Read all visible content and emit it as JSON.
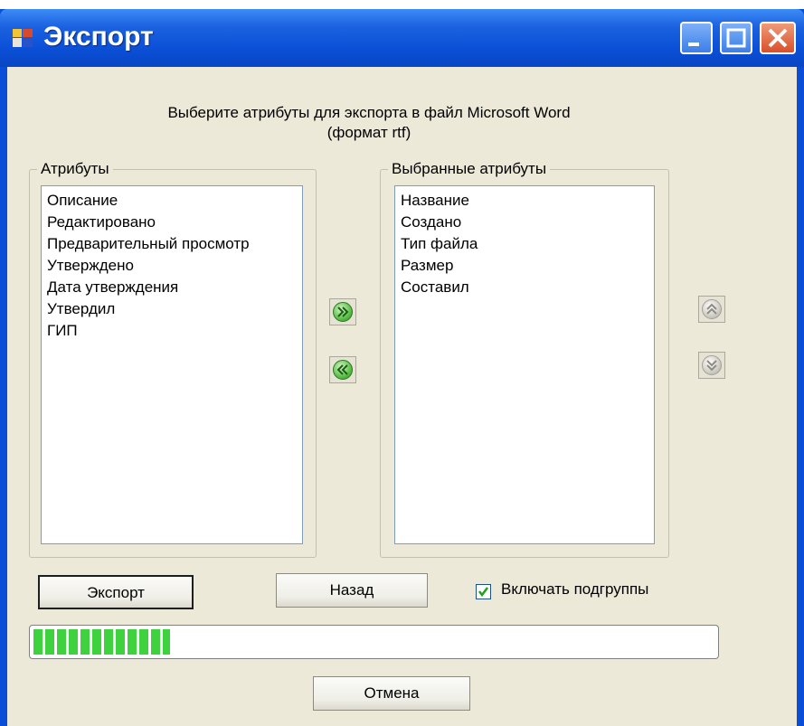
{
  "window": {
    "title": "Экспорт",
    "buttons": {
      "minimize": "minimize-icon",
      "maximize": "maximize-icon",
      "close": "close-icon"
    }
  },
  "heading": {
    "line1": "Выберите атрибуты для экспорта в файл Microsoft Word",
    "line2": "(формат rtf)"
  },
  "available": {
    "label": "Атрибуты",
    "items": [
      "Описание",
      "Редактировано",
      "Предварительный просмотр",
      "Утверждено",
      "Дата утверждения",
      "Утвердил",
      "ГИП"
    ]
  },
  "selected": {
    "label": "Выбранные атрибуты",
    "items": [
      "Название",
      "Создано",
      "Тип файла",
      "Размер",
      "Составил"
    ]
  },
  "transfer": {
    "add_icon": "double-chevron-right-icon",
    "remove_icon": "double-chevron-left-icon"
  },
  "order": {
    "up_icon": "double-chevron-up-icon",
    "down_icon": "double-chevron-down-icon"
  },
  "actions": {
    "export_label": "Экспорт",
    "back_label": "Назад",
    "cancel_label": "Отмена"
  },
  "include_subgroups": {
    "label": "Включать подгруппы",
    "checked": true
  },
  "progress": {
    "fraction": 0.2
  },
  "colors": {
    "title_bar": "#0a4fd6",
    "progress_fill": "#3ed33e",
    "dialog_bg": "#ece9d8"
  }
}
